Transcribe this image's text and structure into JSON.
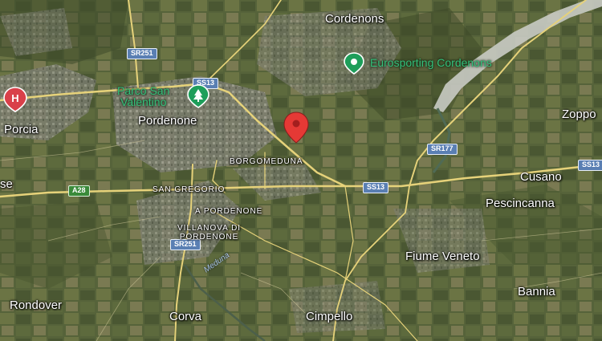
{
  "map": {
    "type": "satellite",
    "colors": {
      "terrain_dark": "#3f4a2c",
      "terrain_mid": "#5f6a3e",
      "urban": "#8a8b80",
      "road": "#e6d27a",
      "pin_red": "#e53935",
      "poi_green": "#1e9e5a",
      "hospital_red": "#d9404a"
    },
    "towns": [
      {
        "key": "cordenons",
        "label": "Cordenons"
      },
      {
        "key": "porcia",
        "label": "Porcia"
      },
      {
        "key": "pordenone",
        "label": "Pordenone"
      },
      {
        "key": "zoppola",
        "label": "Zoppo"
      },
      {
        "key": "cusano",
        "label": "Cusano"
      },
      {
        "key": "pescincanna",
        "label": "Pescincanna"
      },
      {
        "key": "fiume-veneto",
        "label": "Fiume Veneto"
      },
      {
        "key": "bannia",
        "label": "Bannia"
      },
      {
        "key": "rondover",
        "label": "Rondover"
      },
      {
        "key": "corva",
        "label": "Corva"
      },
      {
        "key": "cimpello",
        "label": "Cimpello"
      },
      {
        "key": "se",
        "label": "se"
      }
    ],
    "districts": [
      {
        "key": "borgomeduna",
        "label": "BORGOMEDUNA"
      },
      {
        "key": "san-gregorio",
        "label": "SAN GREGORIO"
      },
      {
        "key": "a-pordenone",
        "label": "A PORDENONE"
      },
      {
        "key": "villanova",
        "label": "VILLANOVA DI\nPORDENONE"
      }
    ],
    "roads": [
      {
        "key": "sr251-top",
        "label": "SR251"
      },
      {
        "key": "ss13-top",
        "label": "SS13"
      },
      {
        "key": "sr177",
        "label": "SR177"
      },
      {
        "key": "ss13-mid",
        "label": "SS13"
      },
      {
        "key": "a28",
        "label": "A28"
      },
      {
        "key": "sr251-bottom",
        "label": "SR251"
      },
      {
        "key": "ss13-right",
        "label": "SS13"
      }
    ],
    "rivers": [
      {
        "key": "meduna",
        "label": "Meduna"
      }
    ],
    "pois": [
      {
        "key": "parco",
        "label": "Parco San\nValentino",
        "icon": "tree-icon"
      },
      {
        "key": "eurosporting",
        "label": "Eurosporting Cordenons",
        "icon": "location-dot-icon"
      }
    ],
    "hospital": {
      "label": "H"
    }
  }
}
